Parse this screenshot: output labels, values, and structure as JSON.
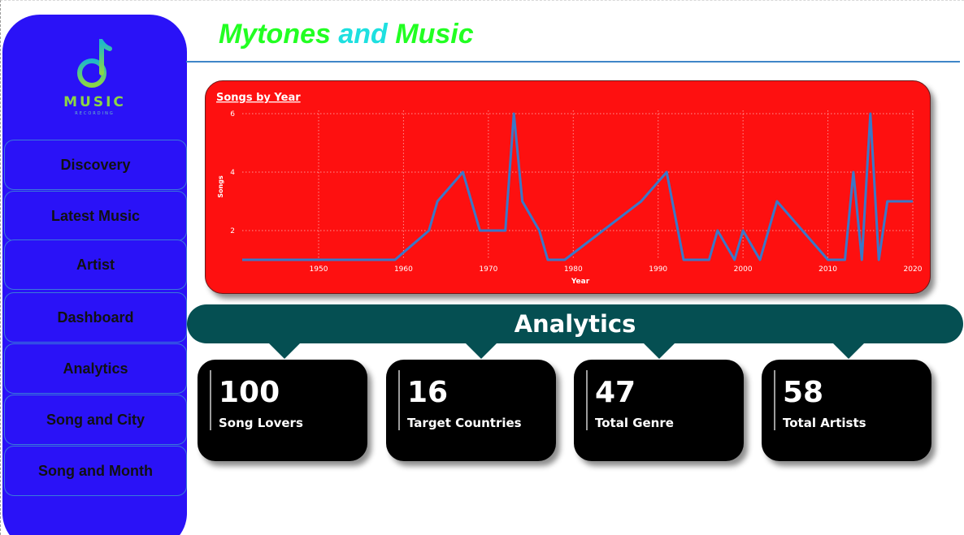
{
  "sidebar": {
    "logo": {
      "name": "music-note-icon",
      "text": "MUSIC",
      "subtext": "RECORDING",
      "colors": [
        "#8bd645",
        "#1fb8c8"
      ]
    },
    "items": [
      {
        "label": "Discovery"
      },
      {
        "label": "Latest Music"
      },
      {
        "label": "Artist"
      },
      {
        "label": "Dashboard"
      },
      {
        "label": "Analytics"
      },
      {
        "label": "Song and City"
      },
      {
        "label": "Song and Month"
      }
    ]
  },
  "header": {
    "title_part1": "Mytones ",
    "title_part2": "and",
    "title_part3": " Music"
  },
  "colors": {
    "sidebar_bg": "#2a12f7",
    "chart_bg": "#fe1010",
    "line": "#3a78c8",
    "banner": "#054f52",
    "kpi_bg": "#000000"
  },
  "chart_data": {
    "type": "line",
    "title": "Songs by Year",
    "xlabel": "Year",
    "ylabel": "Songs",
    "xlim": [
      1941,
      2020
    ],
    "ylim": [
      1,
      6
    ],
    "xticks": [
      1950,
      1960,
      1970,
      1980,
      1990,
      2000,
      2010,
      2020
    ],
    "yticks": [
      2,
      4,
      6
    ],
    "grid": true,
    "x": [
      1941,
      1959,
      1963,
      1964,
      1967,
      1969,
      1972,
      1973,
      1974,
      1976,
      1977,
      1979,
      1988,
      1991,
      1993,
      1996,
      1997,
      1999,
      2000,
      2002,
      2004,
      2010,
      2012,
      2013,
      2014,
      2015,
      2016,
      2017,
      2020
    ],
    "values": [
      1,
      1,
      2,
      3,
      4,
      2,
      2,
      6,
      3,
      2,
      1,
      1,
      3,
      4,
      1,
      1,
      2,
      1,
      2,
      1,
      3,
      1,
      1,
      4,
      1,
      6,
      1,
      3,
      3
    ]
  },
  "analytics": {
    "banner": "Analytics",
    "cards": [
      {
        "value": "100",
        "label": "Song Lovers"
      },
      {
        "value": "16",
        "label": "Target Countries"
      },
      {
        "value": "47",
        "label": "Total Genre"
      },
      {
        "value": "58",
        "label": "Total Artists"
      }
    ]
  }
}
